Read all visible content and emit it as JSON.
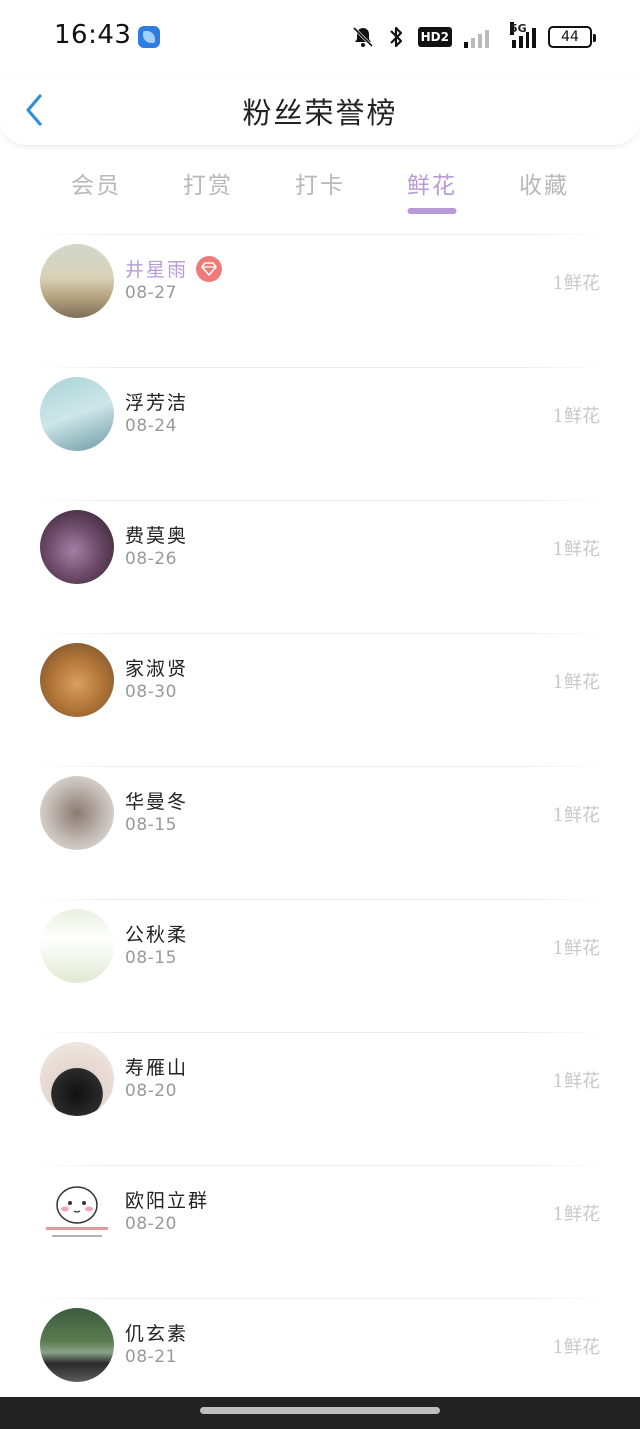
{
  "status_bar": {
    "time": "16:43",
    "network_label": "HD2",
    "network_5g": "5G",
    "battery": "44",
    "icons": [
      "app-icon",
      "bell-muted-icon",
      "bluetooth-icon",
      "hd-icon",
      "signal-icon",
      "signal-5g-icon",
      "battery-icon"
    ]
  },
  "header": {
    "title": "粉丝荣誉榜",
    "back_icon": "chevron-left-icon"
  },
  "tabs": [
    {
      "label": "会员",
      "active": false
    },
    {
      "label": "打赏",
      "active": false
    },
    {
      "label": "打卡",
      "active": false
    },
    {
      "label": "鲜花",
      "active": true
    },
    {
      "label": "收藏",
      "active": false
    }
  ],
  "colors": {
    "accent": "#b89ad8",
    "badge": "#f07a7a",
    "muted": "#c8c8c8",
    "back_arrow": "#2f8fd8"
  },
  "fans": [
    {
      "name": "井星雨",
      "date": "08-27",
      "count": "1鲜花",
      "vip": true
    },
    {
      "name": "浮芳洁",
      "date": "08-24",
      "count": "1鲜花",
      "vip": false
    },
    {
      "name": "费莫奥",
      "date": "08-26",
      "count": "1鲜花",
      "vip": false
    },
    {
      "name": "家淑贤",
      "date": "08-30",
      "count": "1鲜花",
      "vip": false
    },
    {
      "name": "华曼冬",
      "date": "08-15",
      "count": "1鲜花",
      "vip": false
    },
    {
      "name": "公秋柔",
      "date": "08-15",
      "count": "1鲜花",
      "vip": false
    },
    {
      "name": "寿雁山",
      "date": "08-20",
      "count": "1鲜花",
      "vip": false
    },
    {
      "name": "欧阳立群",
      "date": "08-20",
      "count": "1鲜花",
      "vip": false
    },
    {
      "name": "仉玄素",
      "date": "08-21",
      "count": "1鲜花",
      "vip": false
    }
  ]
}
